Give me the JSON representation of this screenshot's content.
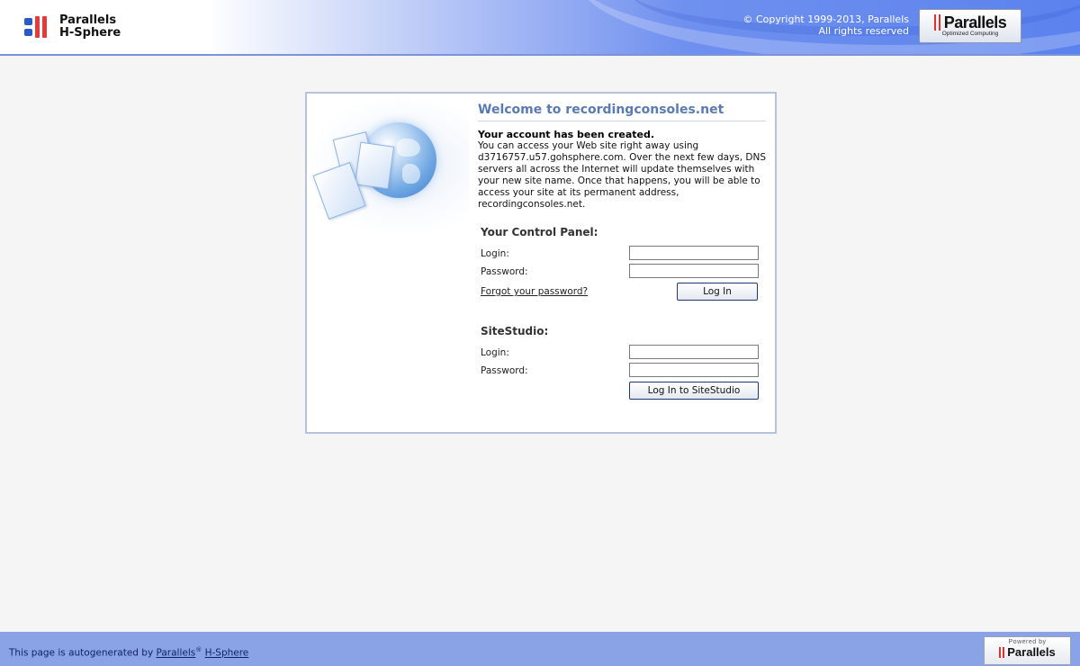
{
  "header": {
    "logo_line1": "Parallels",
    "logo_line2": "H-Sphere",
    "copyright_line1": "© Copyright 1999-2013, Parallels",
    "copyright_line2": "All rights reserved",
    "brand_name": "Parallels",
    "brand_tagline": "Optimized Computing"
  },
  "welcome": {
    "title": "Welcome to recordingconsoles.net",
    "created": "Your account has been created.",
    "info": "You can access your Web site right away using d3716757.u57.gohsphere.com. Over the next few days, DNS servers all across the Internet will update themselves with your new site name. Once that happens, you will be able to access your site at its permanent address, recordingconsoles.net."
  },
  "control_panel": {
    "title": "Your Control Panel:",
    "login_label": "Login:",
    "password_label": "Password:",
    "login_value": "",
    "password_value": "",
    "forgot_link": "Forgot your password?",
    "login_button": "Log In"
  },
  "sitestudio": {
    "title": "SiteStudio:",
    "login_label": "Login:",
    "password_label": "Password:",
    "login_value": "",
    "password_value": "",
    "login_button": "Log In to SiteStudio"
  },
  "footer": {
    "text_prefix": "This page is autogenerated by",
    "parallels_link": "Parallels",
    "registered_mark": "®",
    "hsphere_link": "H-Sphere",
    "powered_by": "Powered by",
    "powered_brand": "Parallels"
  },
  "colors": {
    "title_blue": "#5a7ab5",
    "footer_blue": "#8aa3e7",
    "header_blue": "#5b82ee",
    "logo_red": "#e43a3a"
  }
}
